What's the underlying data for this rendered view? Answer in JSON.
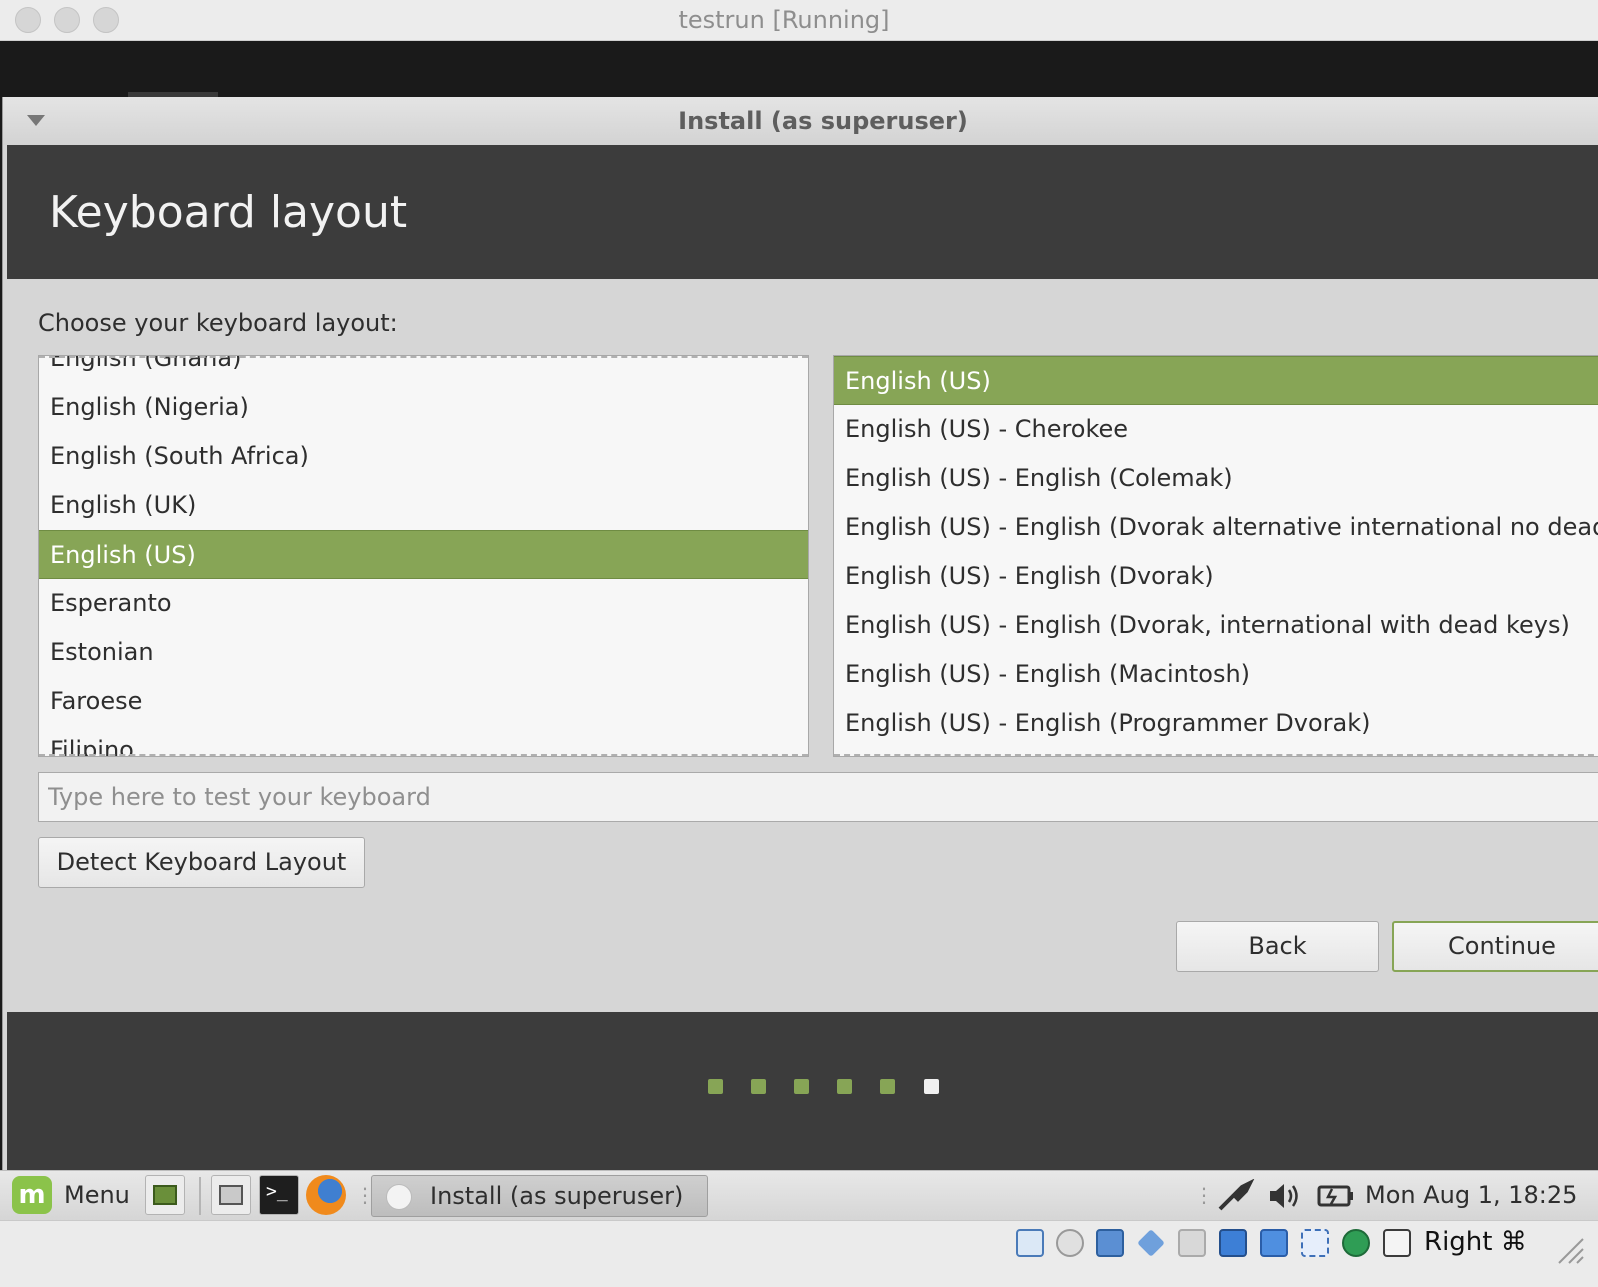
{
  "mac_window": {
    "title": "testrun [Running]"
  },
  "installer": {
    "window_title": "Install (as superuser)",
    "header_title": "Keyboard layout",
    "choose_label": "Choose your keyboard layout:",
    "layouts": [
      {
        "label": "English (Ghana)",
        "selected": false
      },
      {
        "label": "English (Nigeria)",
        "selected": false
      },
      {
        "label": "English (South Africa)",
        "selected": false
      },
      {
        "label": "English (UK)",
        "selected": false
      },
      {
        "label": "English (US)",
        "selected": true
      },
      {
        "label": "Esperanto",
        "selected": false
      },
      {
        "label": "Estonian",
        "selected": false
      },
      {
        "label": "Faroese",
        "selected": false
      },
      {
        "label": "Filipino",
        "selected": false
      }
    ],
    "variants": [
      {
        "label": "English (US)",
        "selected": true
      },
      {
        "label": "English (US) - Cherokee",
        "selected": false
      },
      {
        "label": "English (US) - English (Colemak)",
        "selected": false
      },
      {
        "label": "English (US) - English (Dvorak alternative international no dead keys)",
        "selected": false
      },
      {
        "label": "English (US) - English (Dvorak)",
        "selected": false
      },
      {
        "label": "English (US) - English (Dvorak, international with dead keys)",
        "selected": false
      },
      {
        "label": "English (US) - English (Macintosh)",
        "selected": false
      },
      {
        "label": "English (US) - English (Programmer Dvorak)",
        "selected": false
      }
    ],
    "test_input": {
      "value": "",
      "placeholder": "Type here to test your keyboard"
    },
    "detect_button": "Detect Keyboard Layout",
    "back_button": "Back",
    "continue_button": "Continue",
    "progress": {
      "total_steps": 6,
      "current_step": 6
    }
  },
  "taskbar": {
    "menu_label": "Menu",
    "task_label": "Install (as superuser)",
    "clock": "Mon Aug  1, 18:25"
  },
  "vbox_status": {
    "host_key_label": "Right ⌘"
  },
  "colors": {
    "accent_green": "#87a556",
    "dark_band": "#3c3c3c",
    "window_bg": "#d6d6d6",
    "dot_done": "#87a556",
    "dot_current": "#f0f0f0"
  }
}
